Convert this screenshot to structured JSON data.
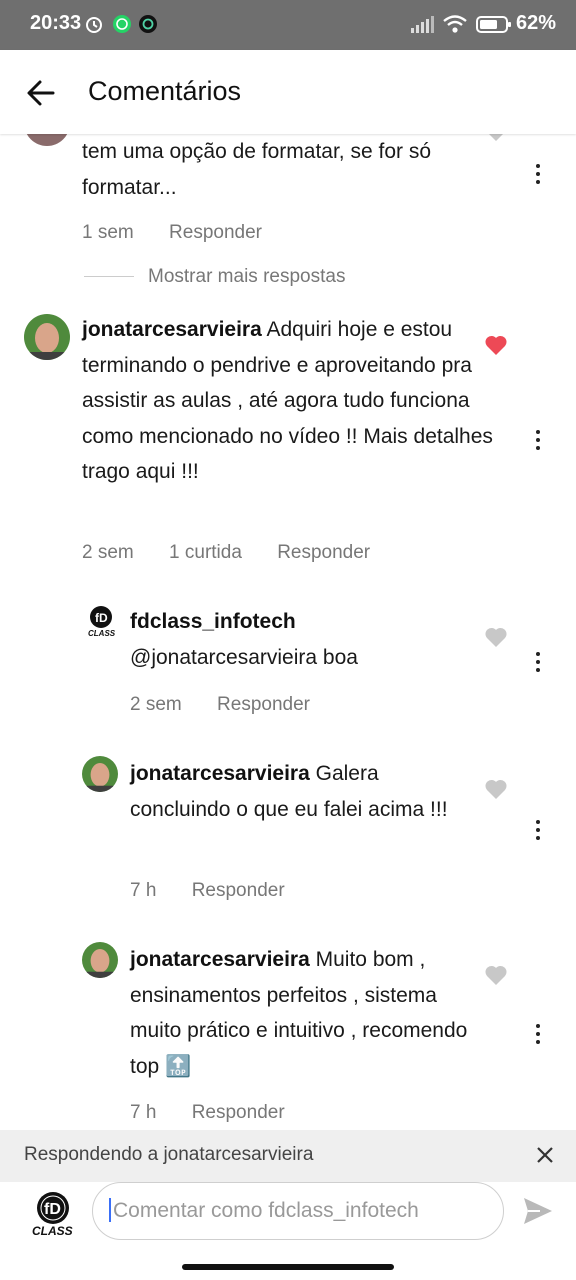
{
  "status": {
    "time": "20:33",
    "battery": "62%"
  },
  "header": {
    "title": "Comentários"
  },
  "partial_comment": {
    "text": "tem uma opção de formatar, se for só formatar...",
    "time": "1 sem",
    "reply": "Responder"
  },
  "show_more": "Mostrar mais respostas",
  "comments": [
    {
      "user": "jonatarcesarvieira",
      "text": " Adquiri hoje e estou terminando o pendrive  e aproveitando pra assistir as aulas , até agora tudo funciona como mencionado no vídeo !! Mais detalhes trago aqui !!!",
      "time": "2 sem",
      "likes": "1 curtida",
      "reply": "Responder",
      "liked": true
    },
    {
      "user": "fdclass_infotech",
      "text": "@jonatarcesarvieira boa",
      "time": "2 sem",
      "reply": "Responder",
      "liked": false
    },
    {
      "user": "jonatarcesarvieira",
      "text": " Galera concluindo o que eu falei acima !!!",
      "time": "7 h",
      "reply": "Responder",
      "liked": false
    },
    {
      "user": "jonatarcesarvieira",
      "text": " Muito bom , ensinamentos perfeitos , sistema muito prático e intuitivo , recomendo top 🔝",
      "time": "7 h",
      "reply": "Responder",
      "liked": false
    }
  ],
  "reply_bar": {
    "text": "Respondendo a jonatarcesarvieira"
  },
  "composer": {
    "placeholder": "Comentar como fdclass_infotech"
  },
  "logo_text": "CLASS",
  "colors": {
    "like_red": "#ed4956",
    "accent": "#3a6ff7"
  }
}
